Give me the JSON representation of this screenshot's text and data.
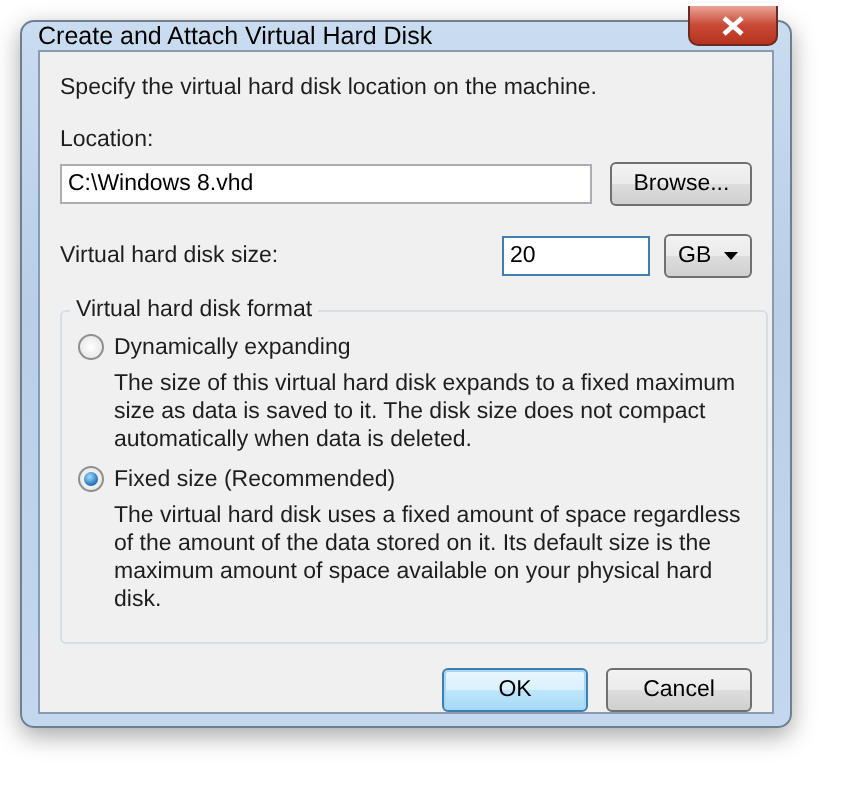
{
  "window": {
    "title": "Create and Attach Virtual Hard Disk"
  },
  "instruction": "Specify the virtual hard disk location on the machine.",
  "location": {
    "label": "Location:",
    "value": "C:\\Windows 8.vhd",
    "browse": "Browse..."
  },
  "size": {
    "label": "Virtual hard disk size:",
    "value": "20",
    "unit": "GB"
  },
  "format": {
    "title": "Virtual hard disk format",
    "options": [
      {
        "label": "Dynamically expanding",
        "description": "The size of this virtual hard disk expands to a fixed maximum size as data is saved to it.  The disk size does not compact automatically when data is deleted.",
        "selected": false
      },
      {
        "label": "Fixed size (Recommended)",
        "description": "The virtual hard disk uses a fixed amount of space regardless of the amount of the data stored on it.  Its default size is the maximum amount of space available on your physical hard disk.",
        "selected": true
      }
    ]
  },
  "buttons": [
    {
      "label": "OK",
      "default": true
    },
    {
      "label": "Cancel",
      "default": false
    }
  ]
}
